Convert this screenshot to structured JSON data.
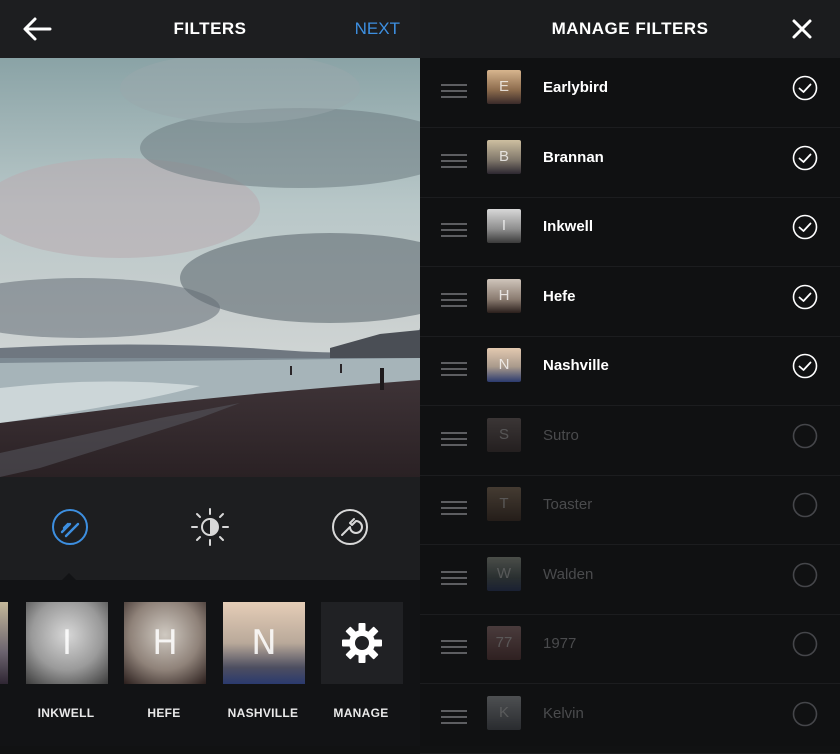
{
  "left_header": {
    "title": "FILTERS",
    "next_label": "NEXT"
  },
  "right_header": {
    "title": "MANAGE FILTERS"
  },
  "tools": [
    "lux-icon",
    "brightness-icon",
    "wrench-icon"
  ],
  "strip": [
    {
      "name": "INKWELL",
      "letter": "I"
    },
    {
      "name": "HEFE",
      "letter": "H"
    },
    {
      "name": "NASHVILLE",
      "letter": "N"
    },
    {
      "name": "MANAGE",
      "letter": ""
    }
  ],
  "filters": [
    {
      "name": "Earlybird",
      "letter": "E",
      "enabled": true
    },
    {
      "name": "Brannan",
      "letter": "B",
      "enabled": true
    },
    {
      "name": "Inkwell",
      "letter": "I",
      "enabled": true
    },
    {
      "name": "Hefe",
      "letter": "H",
      "enabled": true
    },
    {
      "name": "Nashville",
      "letter": "N",
      "enabled": true
    },
    {
      "name": "Sutro",
      "letter": "S",
      "enabled": false
    },
    {
      "name": "Toaster",
      "letter": "T",
      "enabled": false
    },
    {
      "name": "Walden",
      "letter": "W",
      "enabled": false
    },
    {
      "name": "1977",
      "letter": "77",
      "enabled": false
    },
    {
      "name": "Kelvin",
      "letter": "K",
      "enabled": false
    }
  ],
  "colors": {
    "accent": "#3d8fe0",
    "background": "#101112"
  }
}
